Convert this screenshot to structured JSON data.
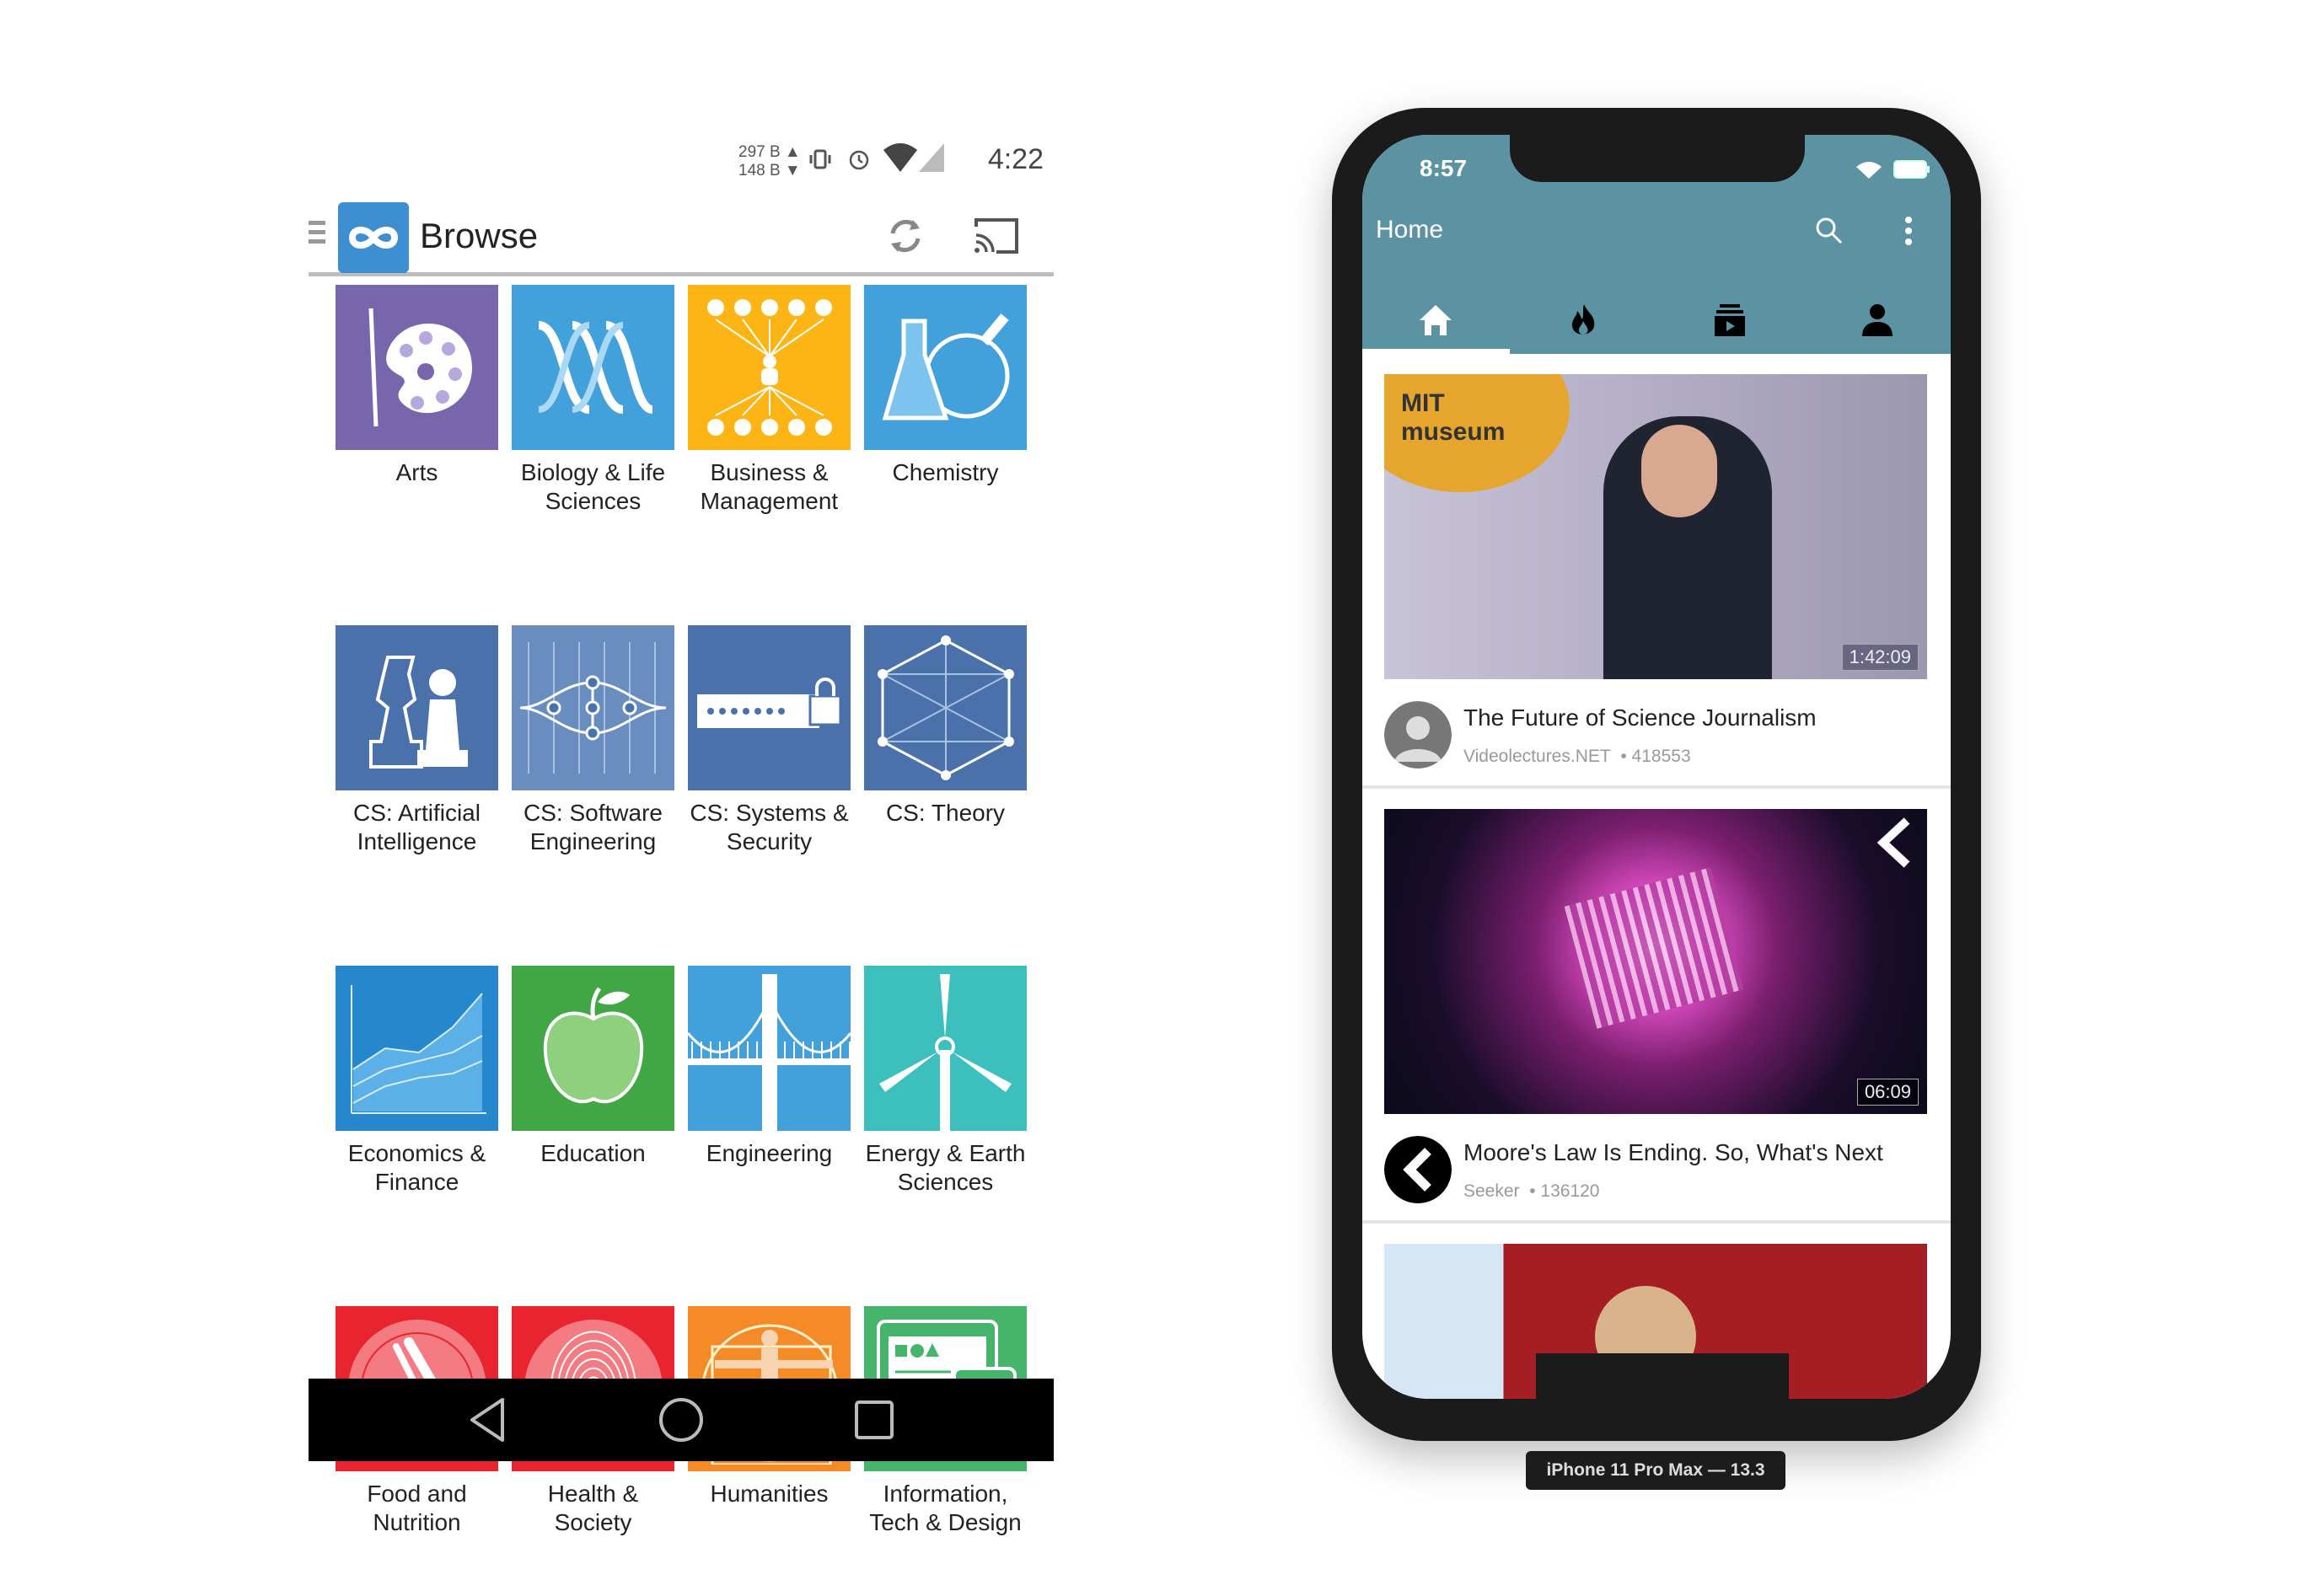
{
  "android": {
    "status": {
      "net_up": "297 B ▲",
      "net_down": "148 B ▼",
      "time": "4:22"
    },
    "toolbar": {
      "title": "Browse"
    },
    "categories": [
      {
        "label": "Arts",
        "color": "#7866ac",
        "icon": "palette-icon"
      },
      {
        "label": "Biology & Life\nSciences",
        "color": "#42a0da",
        "icon": "dna-icon"
      },
      {
        "label": "Business &\nManagement",
        "color": "#fdb515",
        "icon": "network-icon"
      },
      {
        "label": "Chemistry",
        "color": "#42a0da",
        "icon": "flask-icon"
      },
      {
        "label": "CS: Artificial\nIntelligence",
        "color": "#4a71a9",
        "icon": "chess-icon"
      },
      {
        "label": "CS: Software\nEngineering",
        "color": "#4a71a9",
        "icon": "circuit-icon"
      },
      {
        "label": "CS: Systems &\nSecurity",
        "color": "#4a71a9",
        "icon": "lock-icon"
      },
      {
        "label": "CS: Theory",
        "color": "#4a71a9",
        "icon": "graph-icon"
      },
      {
        "label": "Economics &\nFinance",
        "color": "#2687cc",
        "icon": "chart-icon"
      },
      {
        "label": "Education",
        "color": "#41a745",
        "icon": "apple-icon"
      },
      {
        "label": "Engineering",
        "color": "#42a0da",
        "icon": "bridge-icon"
      },
      {
        "label": "Energy & Earth\nSciences",
        "color": "#3cbfbd",
        "icon": "windmill-icon"
      },
      {
        "label": "Food and\nNutrition",
        "color": "#e8242f",
        "icon": "plate-icon"
      },
      {
        "label": "Health &\nSociety",
        "color": "#e8242f",
        "icon": "fingerprint-icon"
      },
      {
        "label": "Humanities",
        "color": "#f58b26",
        "icon": "vitruvian-icon"
      },
      {
        "label": "Information,\nTech & Design",
        "color": "#47b46c",
        "icon": "devices-icon"
      }
    ]
  },
  "iphone": {
    "status_time": "8:57",
    "title": "Home",
    "tabs": [
      {
        "name": "home",
        "active": true
      },
      {
        "name": "trending",
        "active": false
      },
      {
        "name": "subscriptions",
        "active": false
      },
      {
        "name": "account",
        "active": false
      }
    ],
    "videos": [
      {
        "title": "The Future of Science Journalism",
        "channel": "Videolectures.NET",
        "views": "• 418553",
        "duration": "1:42:09"
      },
      {
        "title": "Moore's Law Is Ending. So, What's Next",
        "channel": "Seeker",
        "views": "• 136120",
        "duration": "06:09"
      },
      {
        "title": "",
        "channel": "",
        "views": "",
        "duration": ""
      }
    ],
    "device_label": "iPhone 11 Pro Max — 13.3",
    "accent": "#5b93a3"
  }
}
